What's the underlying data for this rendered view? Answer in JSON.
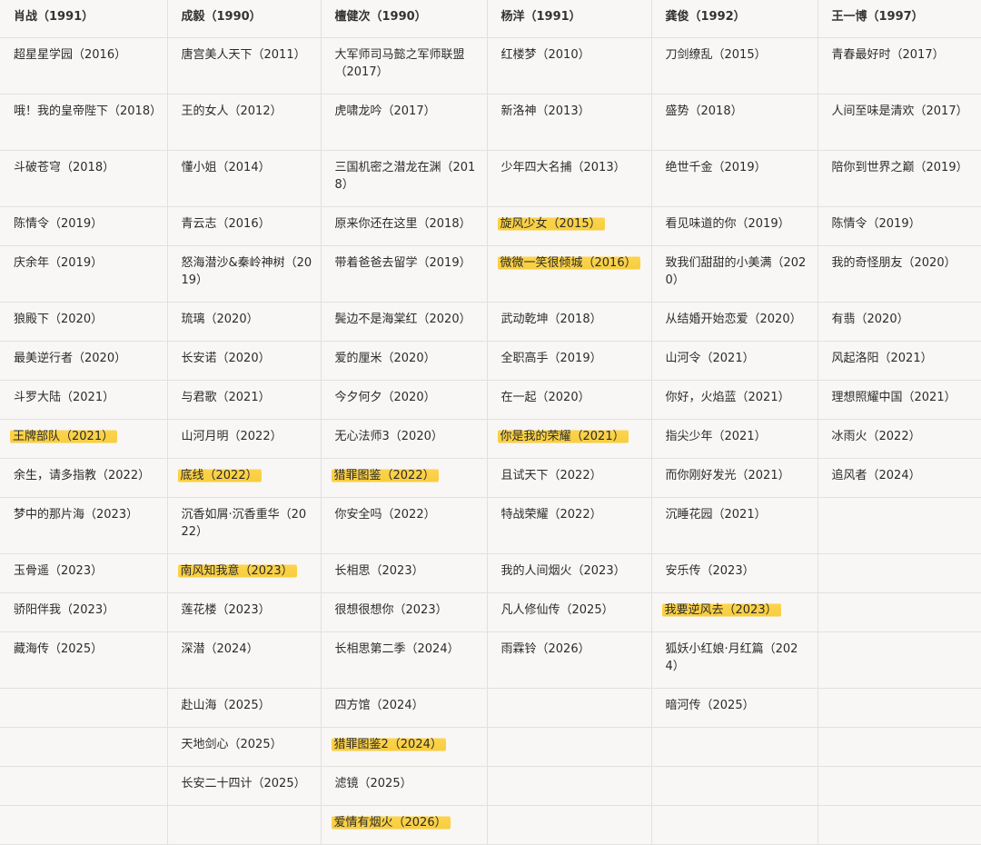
{
  "headers": [
    "肖战（1991）",
    "成毅（1990）",
    "檀健次（1990）",
    "杨洋（1991）",
    "龚俊（1992）",
    "王一博（1997）"
  ],
  "rows": [
    {
      "t": "h2",
      "cells": [
        {
          "text": "超星星学园（2016）"
        },
        {
          "text": "唐宫美人天下（2011）"
        },
        {
          "text": "大军师司马懿之军师联盟（2017）"
        },
        {
          "text": "红楼梦（2010）"
        },
        {
          "text": "刀剑缭乱（2015）"
        },
        {
          "text": "青春最好时（2017）"
        }
      ]
    },
    {
      "t": "h2",
      "cells": [
        {
          "text": "哦！我的皇帝陛下（2018）"
        },
        {
          "text": "王的女人（2012）"
        },
        {
          "text": "虎啸龙吟（2017）"
        },
        {
          "text": "新洛神（2013）"
        },
        {
          "text": "盛势（2018）"
        },
        {
          "text": "人间至味是清欢（2017）"
        }
      ]
    },
    {
      "t": "h2",
      "cells": [
        {
          "text": "斗破苍穹（2018）"
        },
        {
          "text": "懂小姐（2014）"
        },
        {
          "text": "三国机密之潜龙在渊（2018）"
        },
        {
          "text": "少年四大名捕（2013）"
        },
        {
          "text": "绝世千金（2019）"
        },
        {
          "text": "陪你到世界之巅（2019）"
        }
      ]
    },
    {
      "t": "h1",
      "cells": [
        {
          "text": "陈情令（2019）"
        },
        {
          "text": "青云志（2016）"
        },
        {
          "text": "原来你还在这里（2018）"
        },
        {
          "text": "旋风少女（2015）",
          "hl": true
        },
        {
          "text": "看见味道的你（2019）"
        },
        {
          "text": "陈情令（2019）"
        }
      ]
    },
    {
      "t": "h2",
      "cells": [
        {
          "text": "庆余年（2019）"
        },
        {
          "text": "怒海潜沙&秦岭神树（2019）"
        },
        {
          "text": "带着爸爸去留学（2019）"
        },
        {
          "text": "微微一笑很倾城（2016）",
          "hl": true
        },
        {
          "text": "致我们甜甜的小美满（2020）"
        },
        {
          "text": "我的奇怪朋友（2020）"
        }
      ]
    },
    {
      "t": "h1",
      "cells": [
        {
          "text": "狼殿下（2020）"
        },
        {
          "text": "琉璃（2020）"
        },
        {
          "text": "鬓边不是海棠红（2020）"
        },
        {
          "text": "武动乾坤（2018）"
        },
        {
          "text": "从结婚开始恋爱（2020）"
        },
        {
          "text": "有翡（2020）"
        }
      ]
    },
    {
      "t": "h1",
      "cells": [
        {
          "text": "最美逆行者（2020）"
        },
        {
          "text": "长安诺（2020）"
        },
        {
          "text": "爱的厘米（2020）"
        },
        {
          "text": "全职高手（2019）"
        },
        {
          "text": "山河令（2021）"
        },
        {
          "text": "风起洛阳（2021）"
        }
      ]
    },
    {
      "t": "h1",
      "cells": [
        {
          "text": "斗罗大陆（2021）"
        },
        {
          "text": "与君歌（2021）"
        },
        {
          "text": "今夕何夕（2020）"
        },
        {
          "text": "在一起（2020）"
        },
        {
          "text": "你好，火焰蓝（2021）"
        },
        {
          "text": "理想照耀中国（2021）"
        }
      ]
    },
    {
      "t": "h1",
      "cells": [
        {
          "text": "王牌部队（2021）",
          "hl": true
        },
        {
          "text": "山河月明（2022）"
        },
        {
          "text": "无心法师3（2020）"
        },
        {
          "text": "你是我的荣耀（2021）",
          "hl": true
        },
        {
          "text": "指尖少年（2021）"
        },
        {
          "text": "冰雨火（2022）"
        }
      ]
    },
    {
      "t": "h1",
      "cells": [
        {
          "text": "余生，请多指教（2022）"
        },
        {
          "text": "底线（2022）",
          "hl": true
        },
        {
          "text": "猎罪图鉴（2022）",
          "hl": true
        },
        {
          "text": "且试天下（2022）"
        },
        {
          "text": "而你刚好发光（2021）"
        },
        {
          "text": "追风者（2024）"
        }
      ]
    },
    {
      "t": "h2",
      "cells": [
        {
          "text": "梦中的那片海（2023）"
        },
        {
          "text": "沉香如屑·沉香重华（2022）"
        },
        {
          "text": "你安全吗（2022）"
        },
        {
          "text": "特战荣耀（2022）"
        },
        {
          "text": "沉睡花园（2021）"
        },
        {
          "text": ""
        }
      ]
    },
    {
      "t": "h1",
      "cells": [
        {
          "text": "玉骨遥（2023）"
        },
        {
          "text": "南风知我意（2023）",
          "hl": true
        },
        {
          "text": "长相思（2023）"
        },
        {
          "text": "我的人间烟火（2023）"
        },
        {
          "text": "安乐传（2023）"
        },
        {
          "text": ""
        }
      ]
    },
    {
      "t": "h1",
      "cells": [
        {
          "text": "骄阳伴我（2023）"
        },
        {
          "text": "莲花楼（2023）"
        },
        {
          "text": "很想很想你（2023）"
        },
        {
          "text": "凡人修仙传（2025）"
        },
        {
          "text": "我要逆风去（2023）",
          "hl": true
        },
        {
          "text": ""
        }
      ]
    },
    {
      "t": "h2",
      "cells": [
        {
          "text": "藏海传（2025）"
        },
        {
          "text": "深潜（2024）"
        },
        {
          "text": "长相思第二季（2024）"
        },
        {
          "text": "雨霖铃（2026）"
        },
        {
          "text": "狐妖小红娘·月红篇（2024）"
        },
        {
          "text": ""
        }
      ]
    },
    {
      "t": "h1",
      "cells": [
        {
          "text": ""
        },
        {
          "text": "赴山海（2025）"
        },
        {
          "text": "四方馆（2024）"
        },
        {
          "text": ""
        },
        {
          "text": "暗河传（2025）"
        },
        {
          "text": ""
        }
      ]
    },
    {
      "t": "h1",
      "cells": [
        {
          "text": ""
        },
        {
          "text": "天地剑心（2025）"
        },
        {
          "text": "猎罪图鉴2（2024）",
          "hl": true
        },
        {
          "text": ""
        },
        {
          "text": ""
        },
        {
          "text": ""
        }
      ]
    },
    {
      "t": "h1",
      "cells": [
        {
          "text": ""
        },
        {
          "text": "长安二十四计（2025）"
        },
        {
          "text": "滤镜（2025）"
        },
        {
          "text": ""
        },
        {
          "text": ""
        },
        {
          "text": ""
        }
      ]
    },
    {
      "t": "h1",
      "cells": [
        {
          "text": ""
        },
        {
          "text": ""
        },
        {
          "text": "爱情有烟火（2026）",
          "hl": true
        },
        {
          "text": ""
        },
        {
          "text": ""
        },
        {
          "text": ""
        }
      ]
    }
  ]
}
